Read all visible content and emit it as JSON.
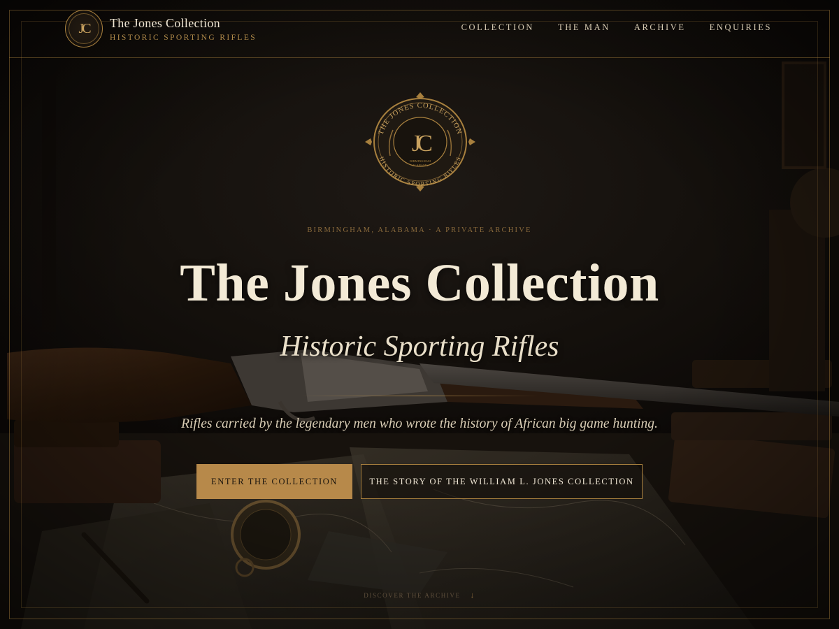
{
  "header": {
    "brand_title": "The Jones Collection",
    "brand_subtitle": "HISTORIC SPORTING RIFLES",
    "brand_monogram": "JC",
    "nav": [
      {
        "label": "COLLECTION"
      },
      {
        "label": "THE MAN"
      },
      {
        "label": "ARCHIVE"
      },
      {
        "label": "ENQUIRIES"
      }
    ]
  },
  "emblem": {
    "top_text": "THE JONES COLLECTION",
    "bottom_text": "HISTORIC SPORTING RIFLES",
    "monogram": "JC",
    "place": "BIRMINGHAM",
    "state": "ALABAMA"
  },
  "hero": {
    "kicker": "BIRMINGHAM, ALABAMA · A PRIVATE ARCHIVE",
    "title": "The Jones Collection",
    "subtitle": "Historic Sporting Rifles",
    "tagline": "Rifles carried by the legendary men who wrote the history of African big game hunting.",
    "primary_button": "ENTER THE COLLECTION",
    "secondary_button": "THE STORY OF THE WILLIAM L. JONES COLLECTION",
    "discover": "DISCOVER THE ARCHIVE",
    "discover_arrow": "↓"
  },
  "colors": {
    "accent_gold": "#b7894a",
    "background": "#0e0b08",
    "text_light": "#efe6d4"
  }
}
